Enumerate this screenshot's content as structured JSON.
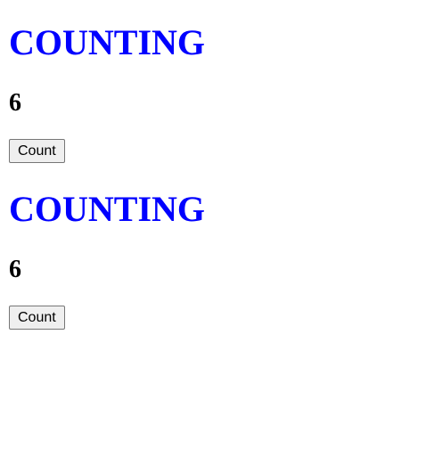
{
  "counters": [
    {
      "title": "COUNTING",
      "value": "6",
      "button_label": "Count"
    },
    {
      "title": "COUNTING",
      "value": "6",
      "button_label": "Count"
    }
  ],
  "colors": {
    "title": "#0000ff",
    "text": "#000000",
    "background": "#ffffff",
    "button_bg": "#efefef",
    "button_border": "#767676"
  }
}
